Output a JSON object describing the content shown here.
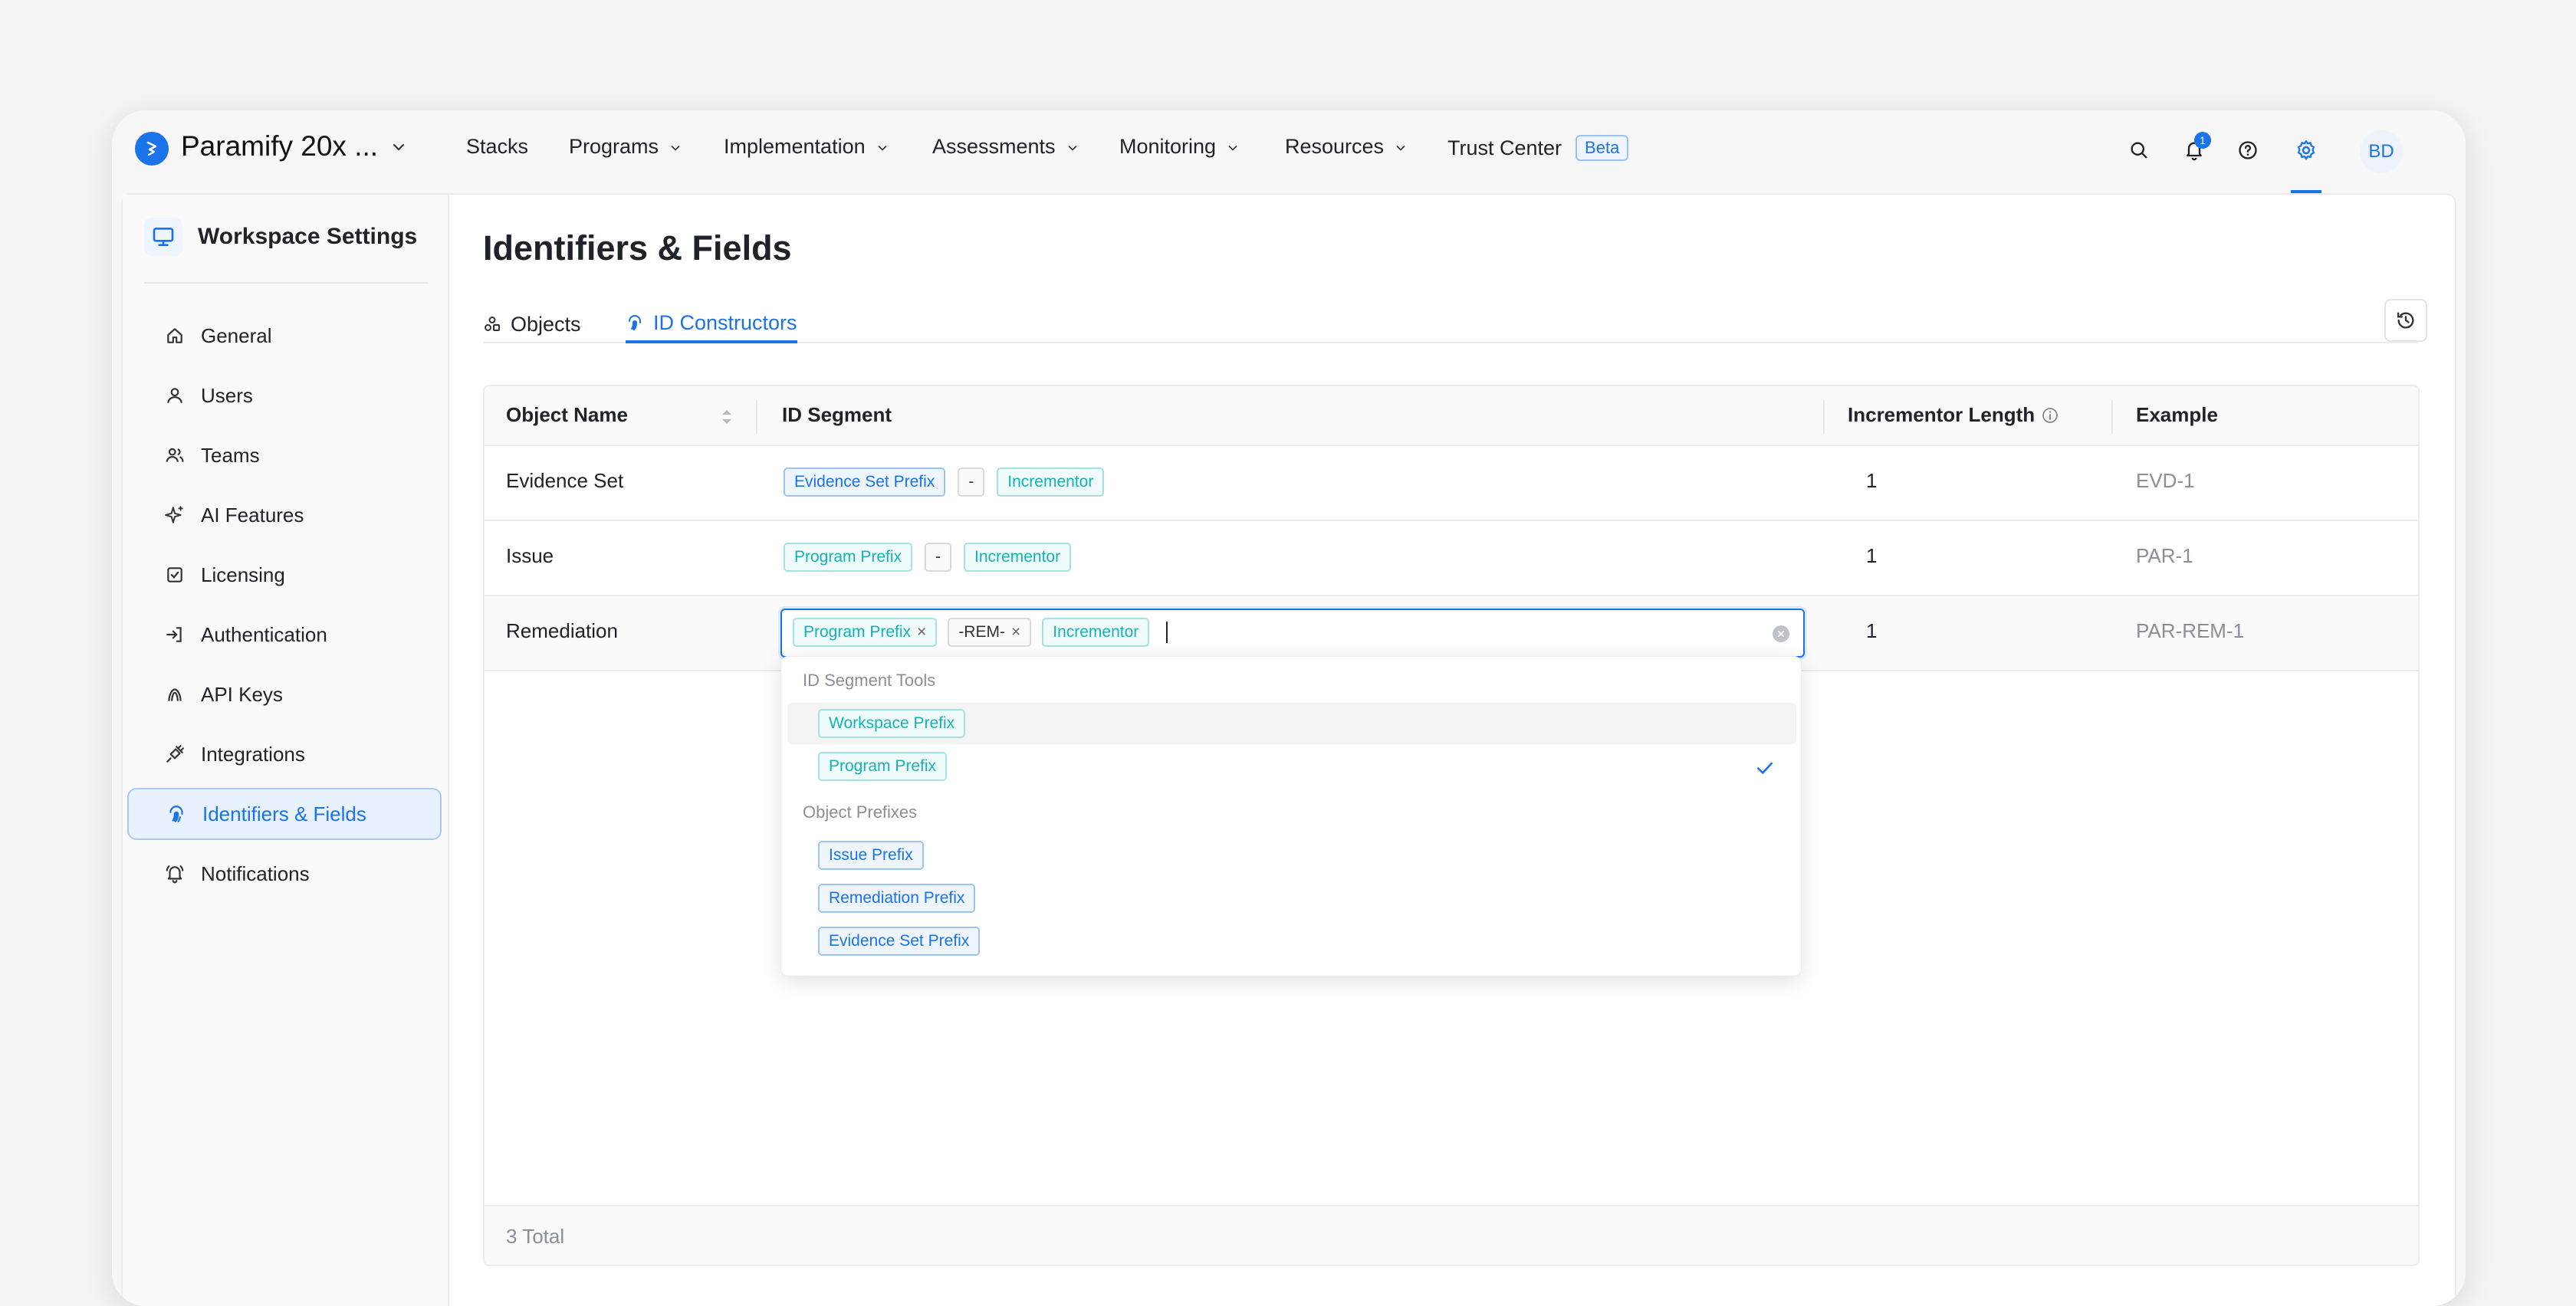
{
  "workspace": {
    "name": "Paramify 20x ..."
  },
  "nav": {
    "items": [
      {
        "label": "Stacks",
        "has_menu": false
      },
      {
        "label": "Programs",
        "has_menu": true
      },
      {
        "label": "Implementation",
        "has_menu": true
      },
      {
        "label": "Assessments",
        "has_menu": true
      },
      {
        "label": "Monitoring",
        "has_menu": true
      },
      {
        "label": "Resources",
        "has_menu": true
      },
      {
        "label": "Trust Center",
        "has_menu": false
      }
    ],
    "beta_badge": "Beta",
    "notification_count": "1",
    "avatar_initials": "BD"
  },
  "sidebar": {
    "title": "Workspace Settings",
    "items": [
      {
        "label": "General",
        "icon": "home-icon"
      },
      {
        "label": "Users",
        "icon": "user-icon"
      },
      {
        "label": "Teams",
        "icon": "users-icon"
      },
      {
        "label": "AI Features",
        "icon": "sparkle-icon"
      },
      {
        "label": "Licensing",
        "icon": "license-icon"
      },
      {
        "label": "Authentication",
        "icon": "login-icon"
      },
      {
        "label": "API Keys",
        "icon": "key-icon"
      },
      {
        "label": "Integrations",
        "icon": "plug-icon"
      },
      {
        "label": "Identifiers & Fields",
        "icon": "fingerprint-icon",
        "active": true
      },
      {
        "label": "Notifications",
        "icon": "bell-icon"
      }
    ]
  },
  "page": {
    "title": "Identifiers & Fields",
    "tabs": [
      {
        "label": "Objects",
        "active": false
      },
      {
        "label": "ID Constructors",
        "active": true
      }
    ]
  },
  "table": {
    "headers": {
      "object_name": "Object Name",
      "id_segment": "ID Segment",
      "incrementor_length": "Incrementor Length",
      "example": "Example"
    },
    "rows": [
      {
        "object_name": "Evidence Set",
        "segments": [
          {
            "label": "Evidence Set Prefix",
            "kind": "blue"
          },
          {
            "label": "-",
            "kind": "gray"
          },
          {
            "label": "Incrementor",
            "kind": "teal"
          }
        ],
        "incrementor_length": "1",
        "example": "EVD-1"
      },
      {
        "object_name": "Issue",
        "segments": [
          {
            "label": "Program Prefix",
            "kind": "teal"
          },
          {
            "label": "-",
            "kind": "gray"
          },
          {
            "label": "Incrementor",
            "kind": "teal"
          }
        ],
        "incrementor_length": "1",
        "example": "PAR-1"
      },
      {
        "object_name": "Remediation",
        "segments": [
          {
            "label": "Program Prefix",
            "kind": "teal",
            "removable": true
          },
          {
            "label": "-REM-",
            "kind": "gray",
            "removable": true
          },
          {
            "label": "Incrementor",
            "kind": "teal"
          }
        ],
        "incrementor_length": "1",
        "example": "PAR-REM-1"
      }
    ],
    "footer": "3 Total"
  },
  "dropdown": {
    "groups": [
      {
        "label": "ID Segment Tools",
        "options": [
          {
            "label": "Workspace Prefix",
            "kind": "teal",
            "selected": false
          },
          {
            "label": "Program Prefix",
            "kind": "teal",
            "selected": true
          }
        ]
      },
      {
        "label": "Object Prefixes",
        "options": [
          {
            "label": "Issue Prefix",
            "kind": "blue",
            "selected": false
          },
          {
            "label": "Remediation Prefix",
            "kind": "blue",
            "selected": false
          },
          {
            "label": "Evidence Set Prefix",
            "kind": "blue",
            "selected": false
          }
        ]
      }
    ]
  },
  "colors": {
    "accent": "#1a73e8",
    "teal": "#13b2b6"
  }
}
